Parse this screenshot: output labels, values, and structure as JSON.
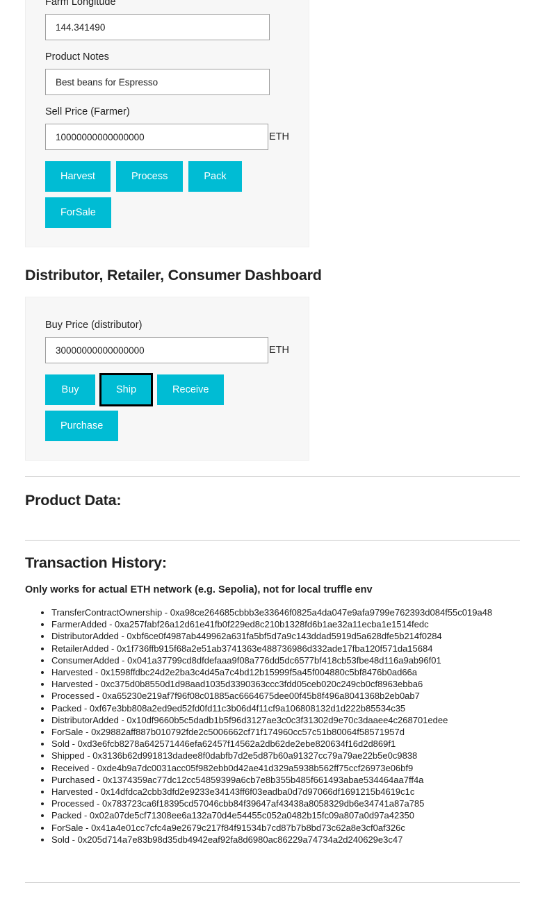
{
  "farmer_section": {
    "fields": [
      {
        "label": "Farm Longitude",
        "value": "144.341490",
        "unit": ""
      },
      {
        "label": "Product Notes",
        "value": "Best beans for Espresso",
        "unit": ""
      },
      {
        "label": "Sell Price (Farmer)",
        "value": "10000000000000000",
        "unit": "ETH"
      }
    ],
    "buttons": [
      {
        "label": "Harvest",
        "focused": false
      },
      {
        "label": "Process",
        "focused": false
      },
      {
        "label": "Pack",
        "focused": false
      },
      {
        "label": "ForSale",
        "focused": false
      }
    ]
  },
  "distributor_section": {
    "title": "Distributor, Retailer, Consumer Dashboard",
    "fields": [
      {
        "label": "Buy Price (distributor)",
        "value": "30000000000000000",
        "unit": "ETH"
      }
    ],
    "buttons": [
      {
        "label": "Buy",
        "focused": false
      },
      {
        "label": "Ship",
        "focused": true
      },
      {
        "label": "Receive",
        "focused": false
      },
      {
        "label": "Purchase",
        "focused": false
      }
    ]
  },
  "product_data": {
    "title": "Product Data:"
  },
  "transaction_history": {
    "title": "Transaction History:",
    "note": "Only works for actual ETH network (e.g. Sepolia), not for local truffle env",
    "items": [
      "TransferContractOwnership - 0xa98ce264685cbbb3e33646f0825a4da047e9afa9799e762393d084f55c019a48",
      "FarmerAdded - 0xa257fabf26a12d61e41fb0f229ed8c210b1328fd6b1ae32a11ecba1e1514fedc",
      "DistributorAdded - 0xbf6ce0f4987ab449962a631fa5bf5d7a9c143ddad5919d5a628dfe5b214f0284",
      "RetailerAdded - 0x1f736ffb915f68a2e51ab3741363e488736986d332ade17fba120f571da15684",
      "ConsumerAdded - 0x041a37799cd8dfdefaaa9f08a776dd5dc6577bf418cb53fbe48d116a9ab96f01",
      "Harvested - 0x1598ffdbc24d2e2ba3c4d45a7c4bd12b15999f5a45f004880c5bf8476b0ad66a",
      "Harvested - 0xc375d0b8550d1d98aad1035d3390363ccc3fdd05ceb020c249cb0cf8963ebba6",
      "Processed - 0xa65230e219af7f96f08c01885ac6664675dee00f45b8f496a8041368b2eb0ab7",
      "Packed - 0xf67e3bb808a2ed9ed52fd0fd11c3b06d4f11cf9a106808132d1d222b85534c35",
      "DistributorAdded - 0x10df9660b5c5dadb1b5f96d3127ae3c0c3f31302d9e70c3daaee4c268701edee",
      "ForSale - 0x29882aff887b010792fde2c5006662cf71f174960cc57c51b80064f58571957d",
      "Sold - 0xd3e6fcb8278a642571446efa62457f14562a2db62de2ebe820634f16d2d869f1",
      "Shipped - 0x3136b62d991813dadee8f0dabfb7d2e5d87b60a91327cc79a79ae22b5e0c9838",
      "Received - 0xde4b9a7dc0031acc05f982ebb0d42ae41d329a5938b562ff75ccf26973e06bf9",
      "Purchased - 0x1374359ac77dc12cc54859399a6cb7e8b355b485f661493abae534464aa7ff4a",
      "Harvested - 0x14dfdca2cbb3dfd2e9233e34143ff6f03eadba0d7d97066df1691215b4619c1c",
      "Processed - 0x783723ca6f18395cd57046cbb84f39647af43438a8058329db6e34741a87a785",
      "Packed - 0x02a07de5cf71308ee6a132a70d4e54455c052a0482b15fc09a807a0d97a42350",
      "ForSale - 0x41a4e01cc7cfc4a9e2679c217f84f91534b7cd87b7b8bd73c62a8e3cf0af326c",
      "Sold - 0x205d714a7e83b98d35db4942eaf92fa8d6980ac86229a74734a2d240629e3c47"
    ]
  },
  "colors": {
    "button": "#00bcd4",
    "card_bg": "#f7f7f7",
    "text": "#212121"
  }
}
